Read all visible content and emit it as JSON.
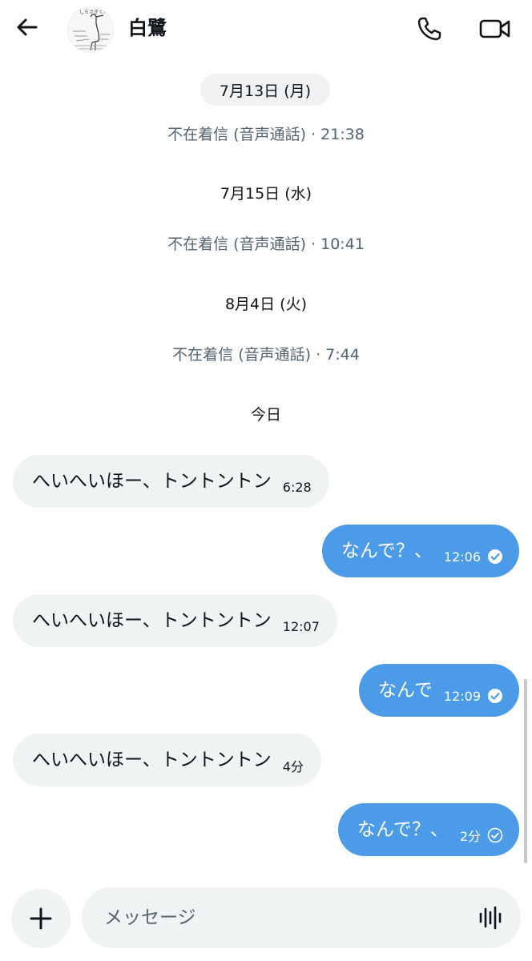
{
  "header": {
    "contact_name": "白鷺",
    "avatar_caption": "しらさぎくん"
  },
  "timeline": {
    "date_1": "7月13日 (月)",
    "missed_1": "不在着信 (音声通話) · 21:38",
    "date_2": "7月15日 (水)",
    "missed_2": "不在着信 (音声通話) · 10:41",
    "date_3": "8月4日 (火)",
    "missed_3": "不在着信 (音声通話) · 7:44",
    "date_4": "今日"
  },
  "messages": [
    {
      "direction": "in",
      "text": "へいへいほー、トントントン",
      "time": "6:28"
    },
    {
      "direction": "out",
      "text": "なんで？、",
      "time": "12:06",
      "status": "read"
    },
    {
      "direction": "in",
      "text": "へいへいほー、トントントン",
      "time": "12:07"
    },
    {
      "direction": "out",
      "text": "なんで",
      "time": "12:09",
      "status": "read"
    },
    {
      "direction": "in",
      "text": "へいへいほー、トントントン",
      "time": "4分"
    },
    {
      "direction": "out",
      "text": "なんで？、",
      "time": "2分",
      "status": "sent"
    }
  ],
  "composer": {
    "placeholder": "メッセージ"
  },
  "icons": {
    "back": "arrow-left-icon",
    "call": "phone-icon",
    "video": "video-camera-icon",
    "add": "plus-icon",
    "voice": "waveform-icon",
    "read": "check-circle-filled-icon",
    "sent": "check-circle-outline-icon"
  },
  "colors": {
    "outgoing_bubble": "#4c9be8",
    "incoming_bubble": "#eff3f4",
    "secondary_text": "#536471"
  }
}
